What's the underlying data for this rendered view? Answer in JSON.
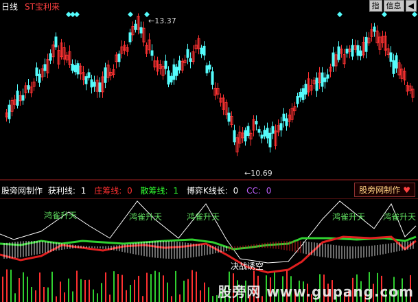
{
  "header": {
    "period": "日线",
    "stock": "ST宝利来",
    "buttons": [
      "指",
      "信息",
      "◀"
    ]
  },
  "price": {
    "high_label": "13.37",
    "low_label": "10.69",
    "colors": {
      "up": "#ff3232",
      "down": "#54fcfc"
    }
  },
  "indicator": {
    "name": "股旁网制作",
    "items": [
      {
        "label": "获利线:",
        "value": "1",
        "color": "#ffffff"
      },
      {
        "label": "庄筹线:",
        "value": "0",
        "color": "#ff3030"
      },
      {
        "label": "散筹线:",
        "value": "1",
        "color": "#30ff30"
      },
      {
        "label": "博弈K线长:",
        "value": "0",
        "color": "#ffffff"
      },
      {
        "label": "CC:",
        "value": "0",
        "color": "#c060ff"
      }
    ],
    "button_label": "股旁网制作",
    "signals_up": [
      "鸿雀升天",
      "鸿雀升天",
      "鸿雀升天",
      "鸿雀升天",
      "鸿雀升天"
    ],
    "signal_down": "决战诱空"
  },
  "watermark": "股旁网 www.gupang.com"
}
